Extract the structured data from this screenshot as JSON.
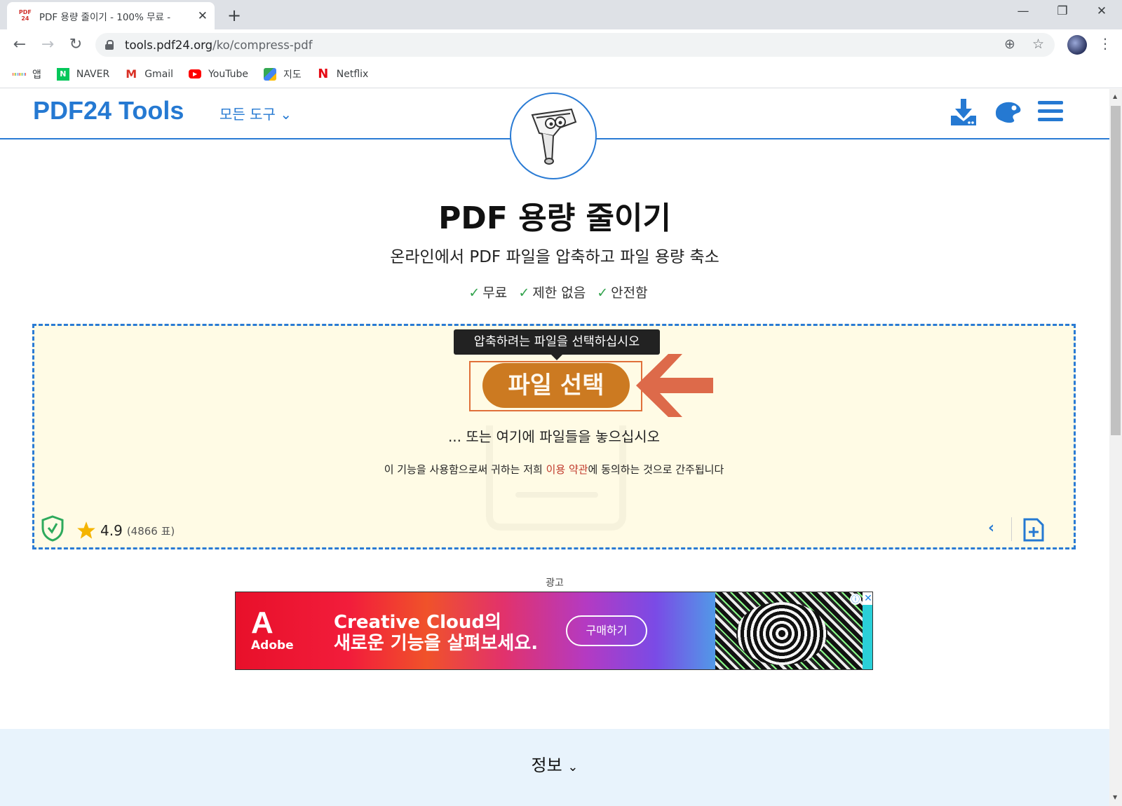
{
  "browser": {
    "tab_title": "PDF 용량 줄이기 - 100% 무료 -",
    "tab_favicon_top": "PDF",
    "tab_favicon_bottom": "24",
    "new_tab_icon": "plus-icon",
    "url_host": "tools.pdf24.org",
    "url_path": "/ko/compress-pdf",
    "bookmarks": [
      {
        "label": "앱",
        "icon": "apps-grid-icon"
      },
      {
        "label": "NAVER",
        "icon": "naver-icon",
        "color": "#03c75a"
      },
      {
        "label": "Gmail",
        "icon": "gmail-icon",
        "color": "#d93025"
      },
      {
        "label": "YouTube",
        "icon": "youtube-icon",
        "color": "#ff0000"
      },
      {
        "label": "지도",
        "icon": "maps-icon",
        "color": "#34a853"
      },
      {
        "label": "Netflix",
        "icon": "netflix-icon",
        "color": "#e50914"
      }
    ]
  },
  "site": {
    "logo": "PDF24 Tools",
    "all_tools": "모든 도구",
    "accent_color": "#2579d2",
    "title": "PDF 용량 줄이기",
    "subtitle": "온라인에서 PDF 파일을 압축하고 파일 용량 축소",
    "features": [
      "무료",
      "제한 없음",
      "안전함"
    ],
    "check_mark": "✓"
  },
  "dropzone": {
    "tooltip": "압축하려는 파일을 선택하십시오",
    "select_button": "파일 선택",
    "button_color": "#cc7a21",
    "drop_hint": "... 또는 여기에 파일들을 놓으십시오",
    "terms_before": "이 기능을 사용함으로써 귀하는 저희 ",
    "terms_link": "이용 약관",
    "terms_after": "에 동의하는 것으로 간주됩니다",
    "rating_value": "4.9",
    "rating_votes": "(4866 표)"
  },
  "ad": {
    "label": "광고",
    "brand": "Adobe",
    "headline_line1": "Creative Cloud의",
    "headline_line2": "새로운 기능을 살펴보세요.",
    "cta": "구매하기",
    "info_glyph": "ⓘ",
    "close_glyph": "✕"
  },
  "info": {
    "title": "정보"
  }
}
